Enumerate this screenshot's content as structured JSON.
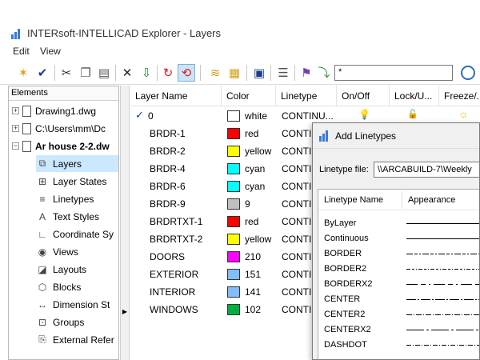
{
  "app": {
    "title": "INTERsoft-INTELLICAD Explorer - Layers"
  },
  "menu": [
    "Edit",
    "View"
  ],
  "toolbar": {
    "filter_value": "*"
  },
  "tree": {
    "header": "Elements",
    "items": [
      {
        "label": "Drawing1.dwg",
        "type": "drawing",
        "expander": "+"
      },
      {
        "label": "C:\\Users\\mm\\Dc",
        "type": "drawing",
        "expander": "+"
      },
      {
        "label": "Ar house 2-2.dw",
        "type": "drawing",
        "expander": "−",
        "bold": true
      },
      {
        "label": "Layers",
        "type": "layers-icon",
        "selected": true
      },
      {
        "label": "Layer States",
        "type": "layer-states-icon"
      },
      {
        "label": "Linetypes",
        "type": "linetypes-icon"
      },
      {
        "label": "Text Styles",
        "type": "text-styles-icon"
      },
      {
        "label": "Coordinate Sy",
        "type": "coordinate-icon"
      },
      {
        "label": "Views",
        "type": "views-icon"
      },
      {
        "label": "Layouts",
        "type": "layouts-icon"
      },
      {
        "label": "Blocks",
        "type": "blocks-icon"
      },
      {
        "label": "Dimension St",
        "type": "dimension-icon"
      },
      {
        "label": "Groups",
        "type": "groups-icon"
      },
      {
        "label": "External Refer",
        "type": "xref-icon"
      }
    ]
  },
  "layers": {
    "columns": [
      "Layer Name",
      "Color",
      "Linetype",
      "On/Off",
      "Lock/U...",
      "Freeze/..."
    ],
    "rows": [
      {
        "name": "0",
        "current": true,
        "color_name": "white",
        "color_hex": "#ffffff",
        "linetype": "CONTINU..."
      },
      {
        "name": "BRDR-1",
        "color_name": "red",
        "color_hex": "#ff0000",
        "linetype": "CONTI"
      },
      {
        "name": "BRDR-2",
        "color_name": "yellow",
        "color_hex": "#ffff00",
        "linetype": "CONTI"
      },
      {
        "name": "BRDR-4",
        "color_name": "cyan",
        "color_hex": "#00ffff",
        "linetype": "CONTI"
      },
      {
        "name": "BRDR-6",
        "color_name": "cyan",
        "color_hex": "#00ffff",
        "linetype": "CONTI"
      },
      {
        "name": "BRDR-9",
        "color_name": "9",
        "color_hex": "#c0c0c0",
        "linetype": "CONTI"
      },
      {
        "name": "BRDRTXT-1",
        "color_name": "red",
        "color_hex": "#ff0000",
        "linetype": "CONTI"
      },
      {
        "name": "BRDRTXT-2",
        "color_name": "yellow",
        "color_hex": "#ffff00",
        "linetype": "CONTI"
      },
      {
        "name": "DOORS",
        "color_name": "210",
        "color_hex": "#ff00ff",
        "linetype": "CONTI"
      },
      {
        "name": "EXTERIOR",
        "color_name": "151",
        "color_hex": "#7fbfff",
        "linetype": "CONTI"
      },
      {
        "name": "INTERIOR",
        "color_name": "141",
        "color_hex": "#7fbfff",
        "linetype": "CONTI"
      },
      {
        "name": "WINDOWS",
        "color_name": "102",
        "color_hex": "#00b03f",
        "linetype": "CONTI"
      }
    ]
  },
  "dialog": {
    "title": "Add Linetypes",
    "file_label": "Linetype file:",
    "file_value": "\\\\ARCABUILD-7\\Weekly",
    "col_name": "Linetype Name",
    "col_appearance": "Appearance",
    "linetypes": [
      {
        "name": "ByLayer",
        "pattern": "solid"
      },
      {
        "name": "Continuous",
        "pattern": "solid"
      },
      {
        "name": "BORDER",
        "pattern": "border"
      },
      {
        "name": "BORDER2",
        "pattern": "border2"
      },
      {
        "name": "BORDERX2",
        "pattern": "borderx2"
      },
      {
        "name": "CENTER",
        "pattern": "center"
      },
      {
        "name": "CENTER2",
        "pattern": "center2"
      },
      {
        "name": "CENTERX2",
        "pattern": "centerx2"
      },
      {
        "name": "DASHDOT",
        "pattern": "dashdot"
      }
    ]
  }
}
